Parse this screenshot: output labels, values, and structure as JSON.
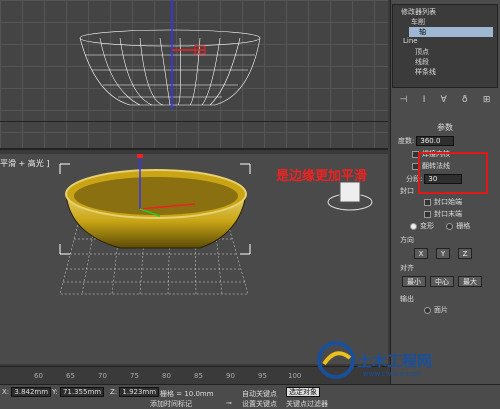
{
  "scene_tree": {
    "items": [
      {
        "label": "车削",
        "selected": false
      },
      {
        "label": "轴",
        "selected": true
      },
      {
        "label": "Line",
        "selected": false
      },
      {
        "label": "顶点",
        "selected": false
      },
      {
        "label": "线段",
        "selected": false
      },
      {
        "label": "样条线",
        "selected": false
      }
    ],
    "dropdown_label": "修改器列表"
  },
  "params": {
    "title": "参数",
    "degrees_label": "度数:",
    "degrees_value": "360.0",
    "weld_core_label": "焊接内核",
    "flip_normals_label": "翻转法线",
    "segments_label": "分段:",
    "segments_value": "30",
    "cap_header": "封口",
    "cap_start_label": "封口始端",
    "cap_end_label": "封口末端",
    "morph_label": "变形",
    "grid_label": "栅格",
    "direction_header": "方向",
    "x_label": "X",
    "y_label": "Y",
    "z_label": "Z",
    "align_header": "对齐",
    "min_label": "最小",
    "center_label": "中心",
    "max_label": "最大",
    "output_header": "输出",
    "face_label": "面片"
  },
  "viewport": {
    "label": "平滑 + 高光 ]",
    "annotation": "是边缘更加平滑"
  },
  "timeline": {
    "ticks": [
      "60",
      "65",
      "70",
      "75",
      "80",
      "85",
      "90",
      "95",
      "100"
    ]
  },
  "status": {
    "x_label": "X:",
    "x_value": "3.842mm",
    "y_label": "Y:",
    "y_value": "71.355mm",
    "z_label": "Z:",
    "z_value": "1.923mm",
    "grid_label": "栅格 = 10.0mm",
    "auto_key": "自动关键点",
    "selected_obj": "选定对象",
    "set_key": "设置关键点",
    "key_filter": "关键点过滤器",
    "add_time_tag": "添加时间标记"
  },
  "watermark": {
    "name": "土木工程网",
    "url": "www.civilcn.com"
  },
  "colors": {
    "bowl_gold": "#c9a515",
    "annotation_red": "#e22222",
    "selection_blue": "#9eb8d4",
    "watermark_blue": "#1a4f9c"
  }
}
